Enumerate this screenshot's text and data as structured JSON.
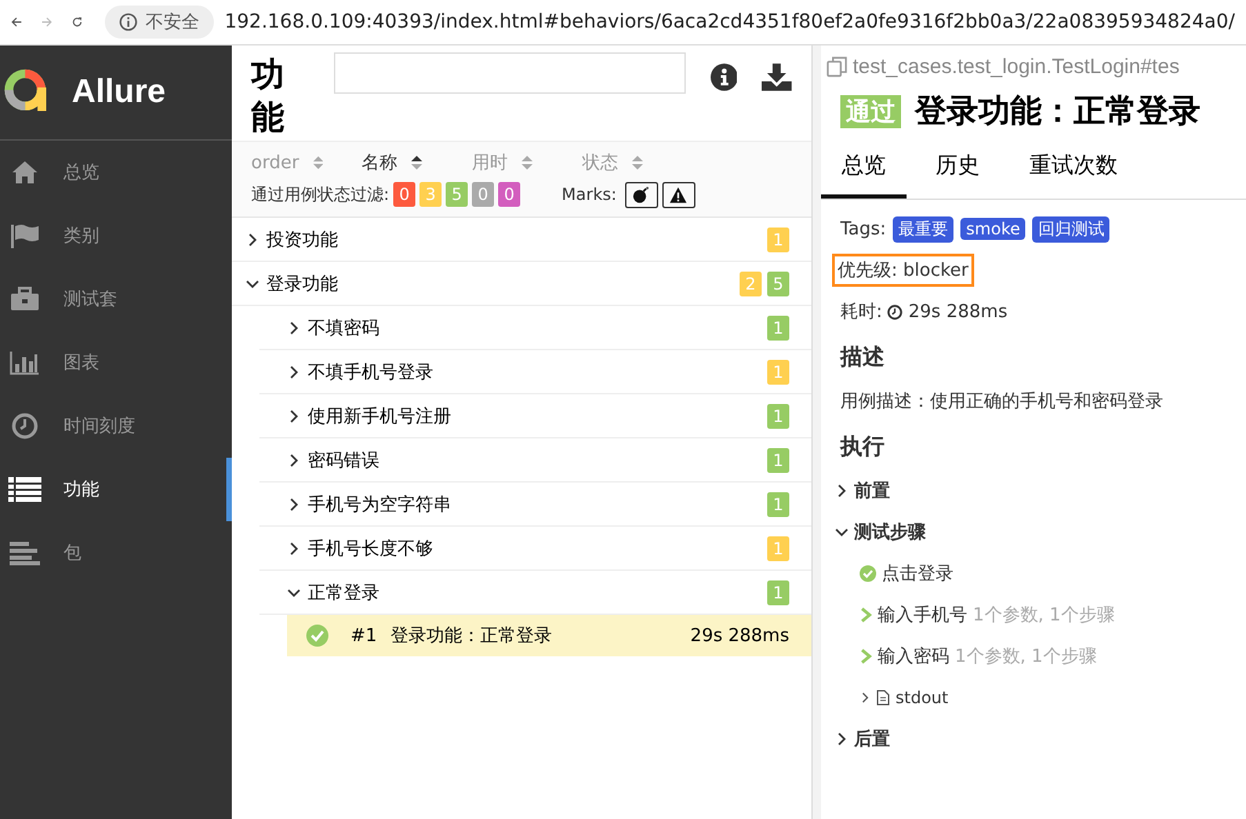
{
  "browser": {
    "security": "不安全",
    "url": "192.168.0.109:40393/index.html#behaviors/6aca2cd4351f80ef2a0fe9316f2bb0a3/22a08395934824a0/"
  },
  "sidebar": {
    "logo": "Allure",
    "items": [
      {
        "label": "总览",
        "kind": "home",
        "selected": false
      },
      {
        "label": "类别",
        "kind": "flag",
        "selected": false
      },
      {
        "label": "测试套",
        "kind": "briefcase",
        "selected": false
      },
      {
        "label": "图表",
        "kind": "chart",
        "selected": false
      },
      {
        "label": "时间刻度",
        "kind": "clock",
        "selected": false
      },
      {
        "label": "功能",
        "kind": "list",
        "selected": true
      },
      {
        "label": "包",
        "kind": "align",
        "selected": false
      }
    ]
  },
  "tree_panel": {
    "title": "功能",
    "sort_columns": [
      {
        "label": "order",
        "selected": false
      },
      {
        "label": "名称",
        "selected": true
      },
      {
        "label": "用时",
        "selected": false
      },
      {
        "label": "状态",
        "selected": false
      }
    ],
    "filter_label": "通过用例状态过滤:",
    "status_filters": [
      {
        "count": "0",
        "color": "#fd5a3e"
      },
      {
        "count": "3",
        "color": "#ffd050"
      },
      {
        "count": "5",
        "color": "#97cc64"
      },
      {
        "count": "0",
        "color": "#aaaaaa"
      },
      {
        "count": "0",
        "color": "#d35ebe"
      }
    ],
    "marks_label": "Marks:",
    "marks": [
      {
        "kind": "bomb"
      },
      {
        "kind": "warning"
      }
    ],
    "tree": [
      {
        "name": "投资功能",
        "expanded": false,
        "counts": [
          {
            "value": "1",
            "color": "#ffd050"
          }
        ]
      },
      {
        "name": "登录功能",
        "expanded": true,
        "counts": [
          {
            "value": "2",
            "color": "#ffd050"
          },
          {
            "value": "5",
            "color": "#97cc64"
          }
        ],
        "children": [
          {
            "name": "不填密码",
            "expanded": false,
            "counts": [
              {
                "value": "1",
                "color": "#97cc64"
              }
            ]
          },
          {
            "name": "不填手机号登录",
            "expanded": false,
            "counts": [
              {
                "value": "1",
                "color": "#ffd050"
              }
            ]
          },
          {
            "name": "使用新手机号注册",
            "expanded": false,
            "counts": [
              {
                "value": "1",
                "color": "#97cc64"
              }
            ]
          },
          {
            "name": "密码错误",
            "expanded": false,
            "counts": [
              {
                "value": "1",
                "color": "#97cc64"
              }
            ]
          },
          {
            "name": "手机号为空字符串",
            "expanded": false,
            "counts": [
              {
                "value": "1",
                "color": "#97cc64"
              }
            ]
          },
          {
            "name": "手机号长度不够",
            "expanded": false,
            "counts": [
              {
                "value": "1",
                "color": "#ffd050"
              }
            ]
          },
          {
            "name": "正常登录",
            "expanded": true,
            "counts": [
              {
                "value": "1",
                "color": "#97cc64"
              }
            ],
            "cases": [
              {
                "number": "#1",
                "name": "登录功能：正常登录",
                "duration": "29s 288ms",
                "selected": true
              }
            ]
          }
        ]
      }
    ]
  },
  "detail": {
    "full_name": "test_cases.test_login.TestLogin#tes",
    "status": "通过",
    "title": "登录功能：正常登录",
    "tabs": [
      {
        "label": "总览",
        "selected": true
      },
      {
        "label": "历史",
        "selected": false
      },
      {
        "label": "重试次数",
        "selected": false
      }
    ],
    "tags_label": "Tags:",
    "tags": [
      "最重要",
      "smoke",
      "回归测试"
    ],
    "severity": "优先级: blocker",
    "duration_label": "耗时:",
    "duration": "29s 288ms",
    "description_heading": "描述",
    "description": "用例描述：使用正确的手机号和密码登录",
    "execution_heading": "执行",
    "sections": [
      {
        "name": "前置",
        "expanded": false
      },
      {
        "name": "测试步骤",
        "expanded": true,
        "steps": [
          {
            "kind": "passed",
            "name": "点击登录"
          },
          {
            "kind": "group",
            "name": "输入手机号",
            "meta": "1个参数, 1个步骤"
          },
          {
            "kind": "group",
            "name": "输入密码",
            "meta": "1个参数, 1个步骤"
          },
          {
            "kind": "attachment",
            "name": "stdout"
          }
        ]
      },
      {
        "name": "后置",
        "expanded": false
      }
    ]
  }
}
